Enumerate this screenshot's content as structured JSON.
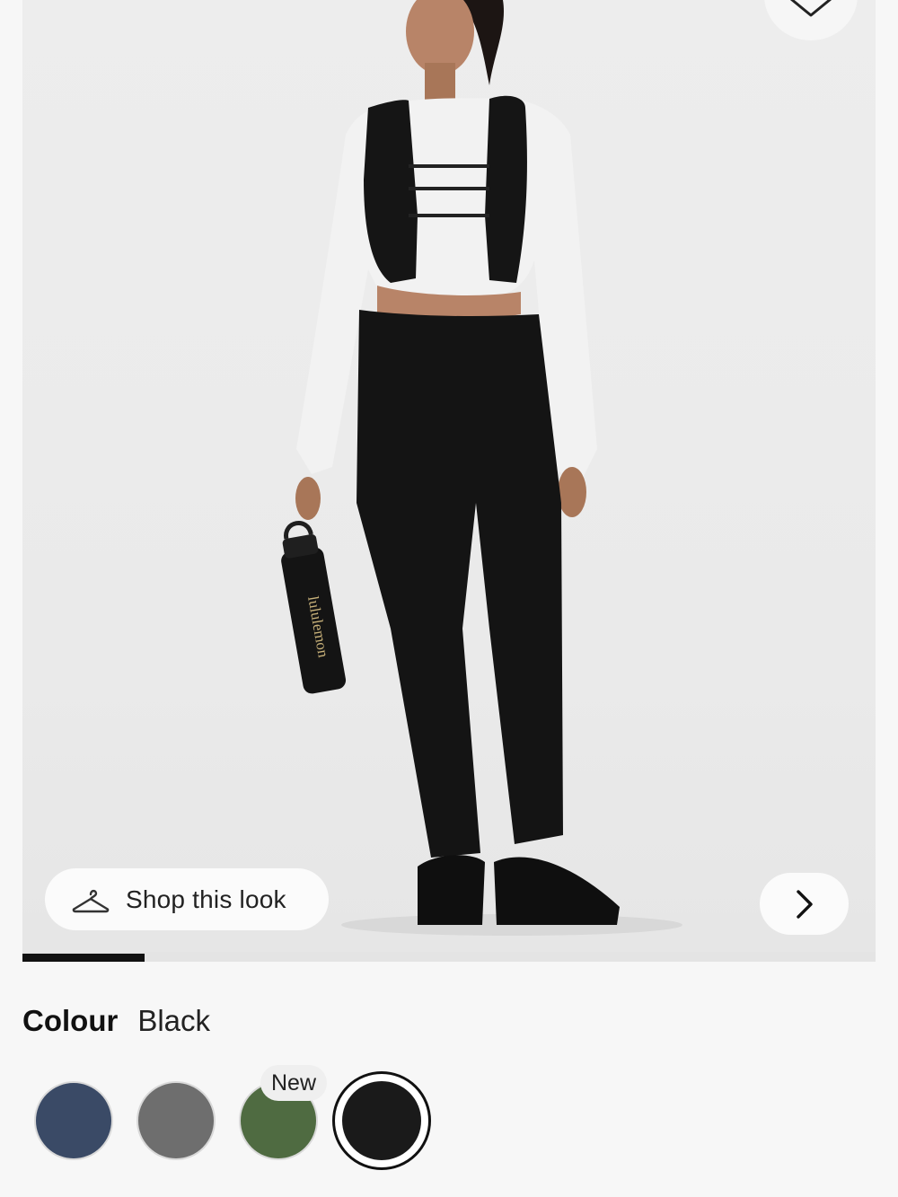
{
  "gallery": {
    "image_alt": "",
    "bottle_brand": "lululemon",
    "progress_fraction": 0.143
  },
  "shop_look": {
    "label": "Shop this look",
    "icon": "hanger-icon"
  },
  "next_icon": "chevron-right-icon",
  "wishlist_icon": "heart-icon",
  "colour": {
    "label": "Colour",
    "value": "Black"
  },
  "swatches": [
    {
      "name": "Navy",
      "color": "#3a4a66"
    },
    {
      "name": "Grey",
      "color": "#6e6e6e"
    },
    {
      "name": "Green",
      "color": "#4f6b41",
      "badge": "New"
    },
    {
      "name": "Black",
      "color": "#1a1a1a",
      "selected": true
    }
  ],
  "colors": {
    "accent": "#111111",
    "background": "#f7f7f7"
  }
}
